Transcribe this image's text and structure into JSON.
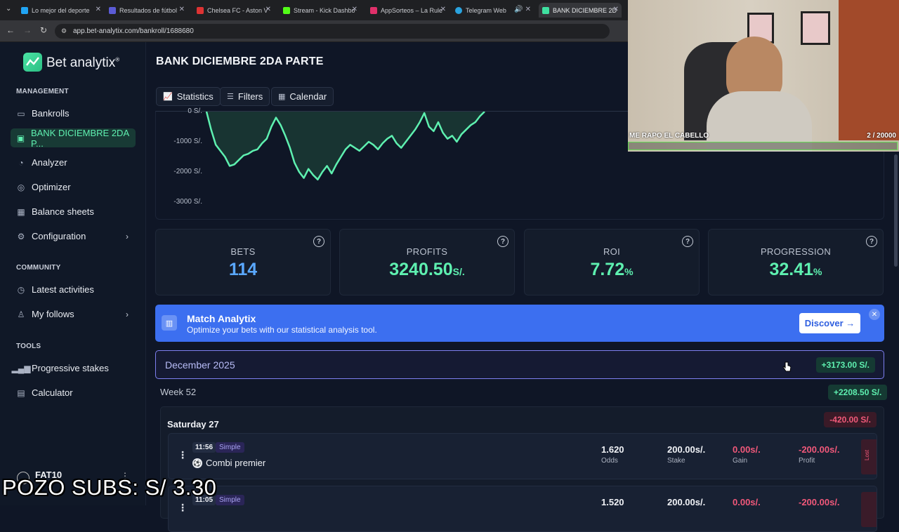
{
  "browser": {
    "tabs": [
      {
        "label": "Lo mejor del deporte",
        "color": "#20a4f3"
      },
      {
        "label": "Resultados de fútbol",
        "color": "#5b5bd6"
      },
      {
        "label": "Chelsea FC - Aston V",
        "color": "#d33"
      },
      {
        "label": "Stream - Kick Dashbo",
        "color": "#53fc18"
      },
      {
        "label": "AppSorteos – La Rule",
        "color": "#e0306a"
      },
      {
        "label": "Telegram Web",
        "color": "#2aa3df"
      },
      {
        "label": "BANK DICIEMBRE 2D",
        "color": "#3fe0a0"
      }
    ],
    "url": "app.bet-analytix.com/bankroll/1688680"
  },
  "sidebar": {
    "logo": "Bet analytix",
    "logo_mark": "®",
    "management_title": "MANAGEMENT",
    "management": [
      {
        "label": "Bankrolls",
        "icon": "wallet-icon"
      },
      {
        "label": "BANK DICIEMBRE 2DA P...",
        "icon": "bankroll-icon"
      },
      {
        "label": "Analyzer",
        "icon": "pie-chart-icon"
      },
      {
        "label": "Optimizer",
        "icon": "optimizer-icon"
      },
      {
        "label": "Balance sheets",
        "icon": "table-icon"
      },
      {
        "label": "Configuration",
        "icon": "gear-icon"
      }
    ],
    "community_title": "COMMUNITY",
    "community": [
      {
        "label": "Latest activities",
        "icon": "clock-icon"
      },
      {
        "label": "My follows",
        "icon": "user-icon"
      }
    ],
    "tools_title": "TOOLS",
    "tools": [
      {
        "label": "Progressive stakes",
        "icon": "bars-icon"
      },
      {
        "label": "Calculator",
        "icon": "calculator-icon"
      }
    ],
    "user": "FAT10"
  },
  "header": {
    "title": "BANK DICIEMBRE 2DA PARTE",
    "buttons": [
      "Statistics",
      "Filters",
      "Calendar"
    ]
  },
  "chart_data": {
    "type": "line",
    "title": "",
    "yticks": [
      "0 S/.",
      "-1000 S/.",
      "-2000 S/.",
      "-3000 S/."
    ],
    "ylim": [
      -3000,
      0
    ],
    "color": "#5ef0b0",
    "values": [
      0,
      -600,
      -1100,
      -1300,
      -1500,
      -1800,
      -1750,
      -1600,
      -1450,
      -1400,
      -1300,
      -1250,
      -1050,
      -900,
      -500,
      -200,
      -450,
      -800,
      -1200,
      -1700,
      -2000,
      -2200,
      -1900,
      -2100,
      -2250,
      -2000,
      -1800,
      -2050,
      -1750,
      -1500,
      -1250,
      -1100,
      -1200,
      -1300,
      -1150,
      -1000,
      -1100,
      -1250,
      -1050,
      -900,
      -800,
      -1050,
      -1200,
      -1000,
      -800,
      -600,
      -350,
      -50,
      -500,
      -650,
      -350,
      -700,
      -900,
      -800,
      -1000,
      -750,
      -600,
      -450,
      -350,
      -150,
      0
    ]
  },
  "stats": [
    {
      "label": "BETS",
      "value": "114",
      "unit": "",
      "color": "#5aa8ff"
    },
    {
      "label": "PROFITS",
      "value": "3240.50",
      "unit": "S/.",
      "color": "#5ef0b0"
    },
    {
      "label": "ROI",
      "value": "7.72",
      "unit": "%",
      "color": "#5ef0b0"
    },
    {
      "label": "PROGRESSION",
      "value": "32.41",
      "unit": "%",
      "color": "#5ef0b0"
    }
  ],
  "banner": {
    "title": "Match Analytix",
    "subtitle": "Optimize your bets with our statistical analysis tool.",
    "button": "Discover →"
  },
  "month": {
    "label": "December 2025",
    "total": "+3173.00 S/."
  },
  "week": {
    "label": "Week 52",
    "total": "+2208.50 S/."
  },
  "day": {
    "label": "Saturday 27",
    "total": "-420.00 S/."
  },
  "bets": [
    {
      "time": "11:56",
      "type": "Simple",
      "name": "Combi premier",
      "odds": "1.620",
      "stake": "200.00s/.",
      "gain": "0.00s/.",
      "profit": "-200.00s/.",
      "status": "Lost"
    },
    {
      "time": "11:05",
      "type": "Simple",
      "name": "",
      "odds": "1.520",
      "stake": "200.00s/.",
      "gain": "0.00s/.",
      "profit": "-200.00s/.",
      "status": "Lost"
    }
  ],
  "bet_labels": {
    "odds": "Odds",
    "stake": "Stake",
    "gain": "Gain",
    "profit": "Profit"
  },
  "stream": {
    "webcam_text": "ME RAPO EL CABELLO",
    "counter": "2  / 20000",
    "pozo": "POZO SUBS: S/ 3.30"
  }
}
